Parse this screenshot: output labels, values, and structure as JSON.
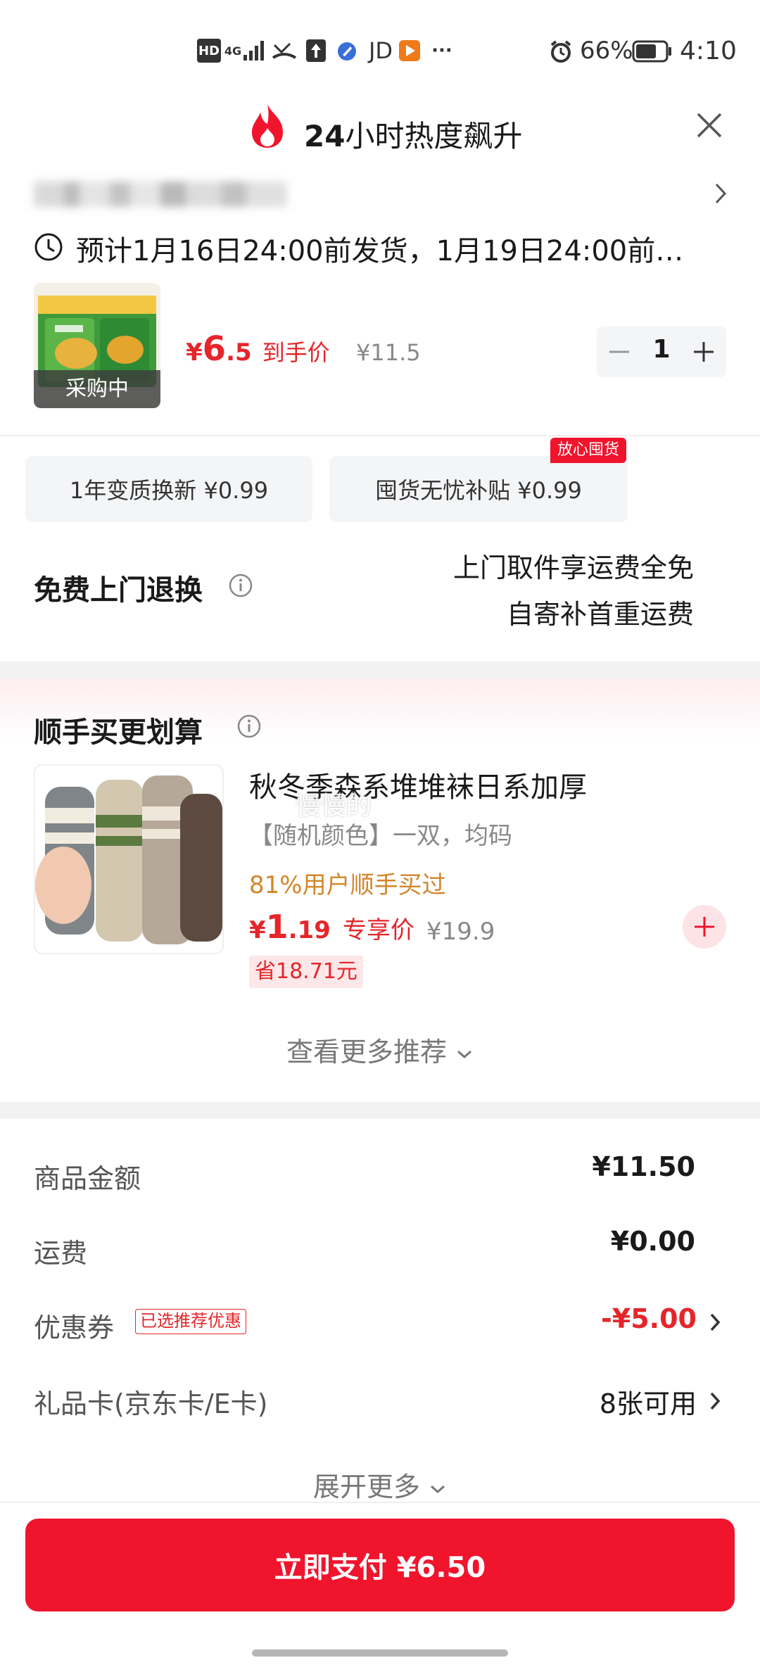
{
  "status_bar": {
    "hd": "HD",
    "network": "4G",
    "jd_label": "JD",
    "more": "···",
    "battery_pct": "66%",
    "time": "4:10"
  },
  "header": {
    "title_number": "24",
    "title_text": "小时热度飙升"
  },
  "delivery": {
    "text": "预计1月16日24:00前发货，1月19日24:00前…"
  },
  "product": {
    "badge": "采购中",
    "price_symbol": "¥",
    "price_int": "6",
    "price_dec": ".5",
    "price_label": "到手价",
    "original_price": "¥11.5",
    "quantity": "1"
  },
  "services": {
    "option1": "1年变质换新 ¥0.99",
    "option2": "囤货无忧补贴 ¥0.99",
    "option2_tag": "放心囤货",
    "return_label": "免费上门退换",
    "return_line1": "上门取件享运费全免",
    "return_line2": "自寄补首重运费"
  },
  "upsell": {
    "title": "顺手买更划算",
    "item": {
      "name": "秋冬季森系堆堆袜日系加厚",
      "spec": "【随机颜色】一双，均码",
      "stat": "81%用户顺手买过",
      "price_symbol": "¥",
      "price_int": "1",
      "price_dec": ".19",
      "price_label": "专享价",
      "original_price": "¥19.9",
      "saving": "省18.71元",
      "overlay_text": "慢慢的"
    },
    "more_link": "查看更多推荐"
  },
  "summary": {
    "goods_label": "商品金额",
    "goods_value": "¥11.50",
    "shipping_label": "运费",
    "shipping_value": "¥0.00",
    "coupon_label": "优惠券",
    "coupon_tag": "已选推荐优惠",
    "coupon_value": "-¥5.00",
    "giftcard_label": "礼品卡(京东卡/E卡)",
    "giftcard_value": "8张可用",
    "expand_link": "展开更多"
  },
  "pay_button": {
    "label": "立即支付 ¥6.50"
  },
  "colors": {
    "accent_red": "#f0142d",
    "price_red": "#e4262b",
    "orange_text": "#d2862a"
  },
  "icons": [
    "flame-icon",
    "close-icon",
    "clock-icon",
    "chevron-right-icon",
    "info-icon",
    "plus-icon",
    "minus-icon",
    "alarm-icon",
    "battery-icon"
  ]
}
